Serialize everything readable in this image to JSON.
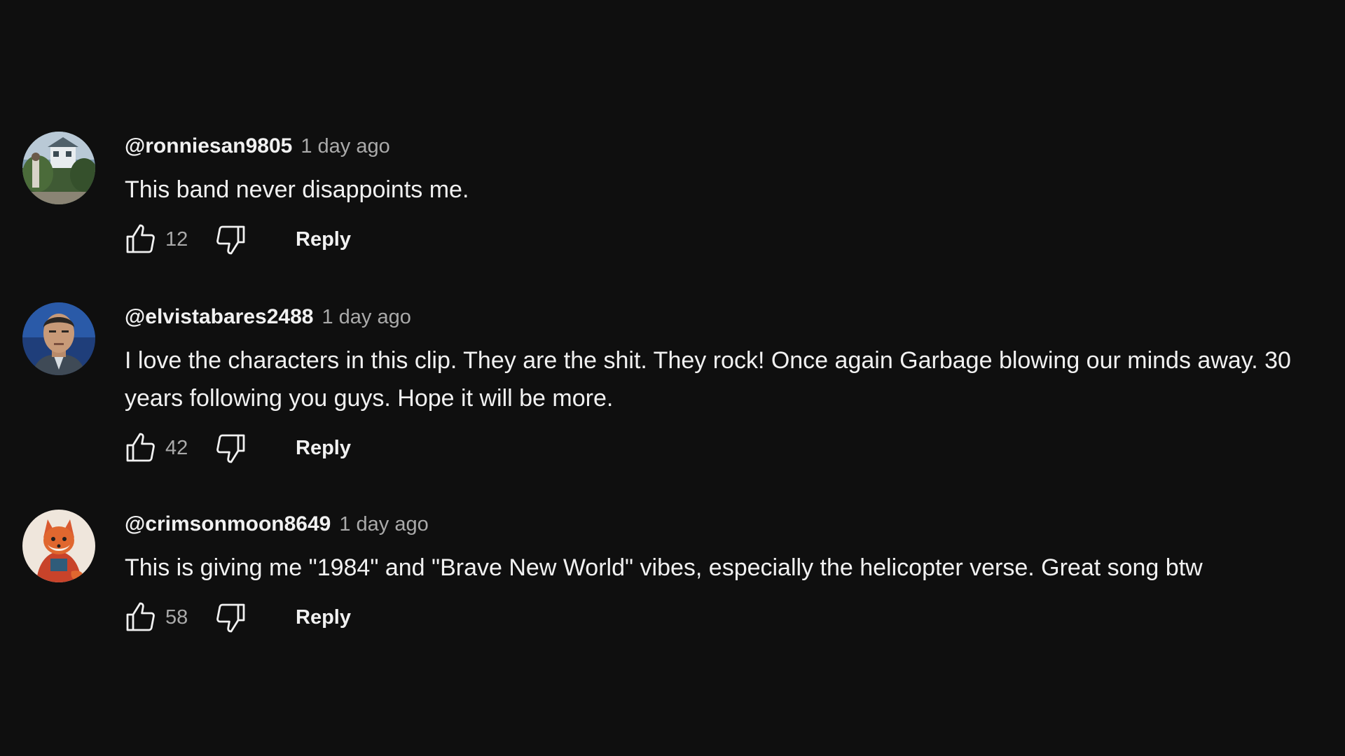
{
  "comments": [
    {
      "author": "@ronniesan9805",
      "time": "1 day ago",
      "text": "This band never disappoints me.",
      "likes": "12",
      "reply_label": "Reply"
    },
    {
      "author": "@elvistabares2488",
      "time": "1 day ago",
      "text": "I love the characters in this clip. They are the shit. They rock! Once again Garbage blowing our minds away. 30 years following you guys. Hope it will be more.",
      "likes": "42",
      "reply_label": "Reply"
    },
    {
      "author": "@crimsonmoon8649",
      "time": "1 day ago",
      "text": "This is giving me \"1984\" and \"Brave New World\" vibes, especially the helicopter verse. Great song btw",
      "likes": "58",
      "reply_label": "Reply"
    }
  ],
  "icons": {
    "like": "thumb-up-icon",
    "dislike": "thumb-down-icon"
  },
  "colors": {
    "background": "#0f0f0f",
    "primary_text": "#f1f1f1",
    "secondary_text": "#aaaaaa"
  }
}
